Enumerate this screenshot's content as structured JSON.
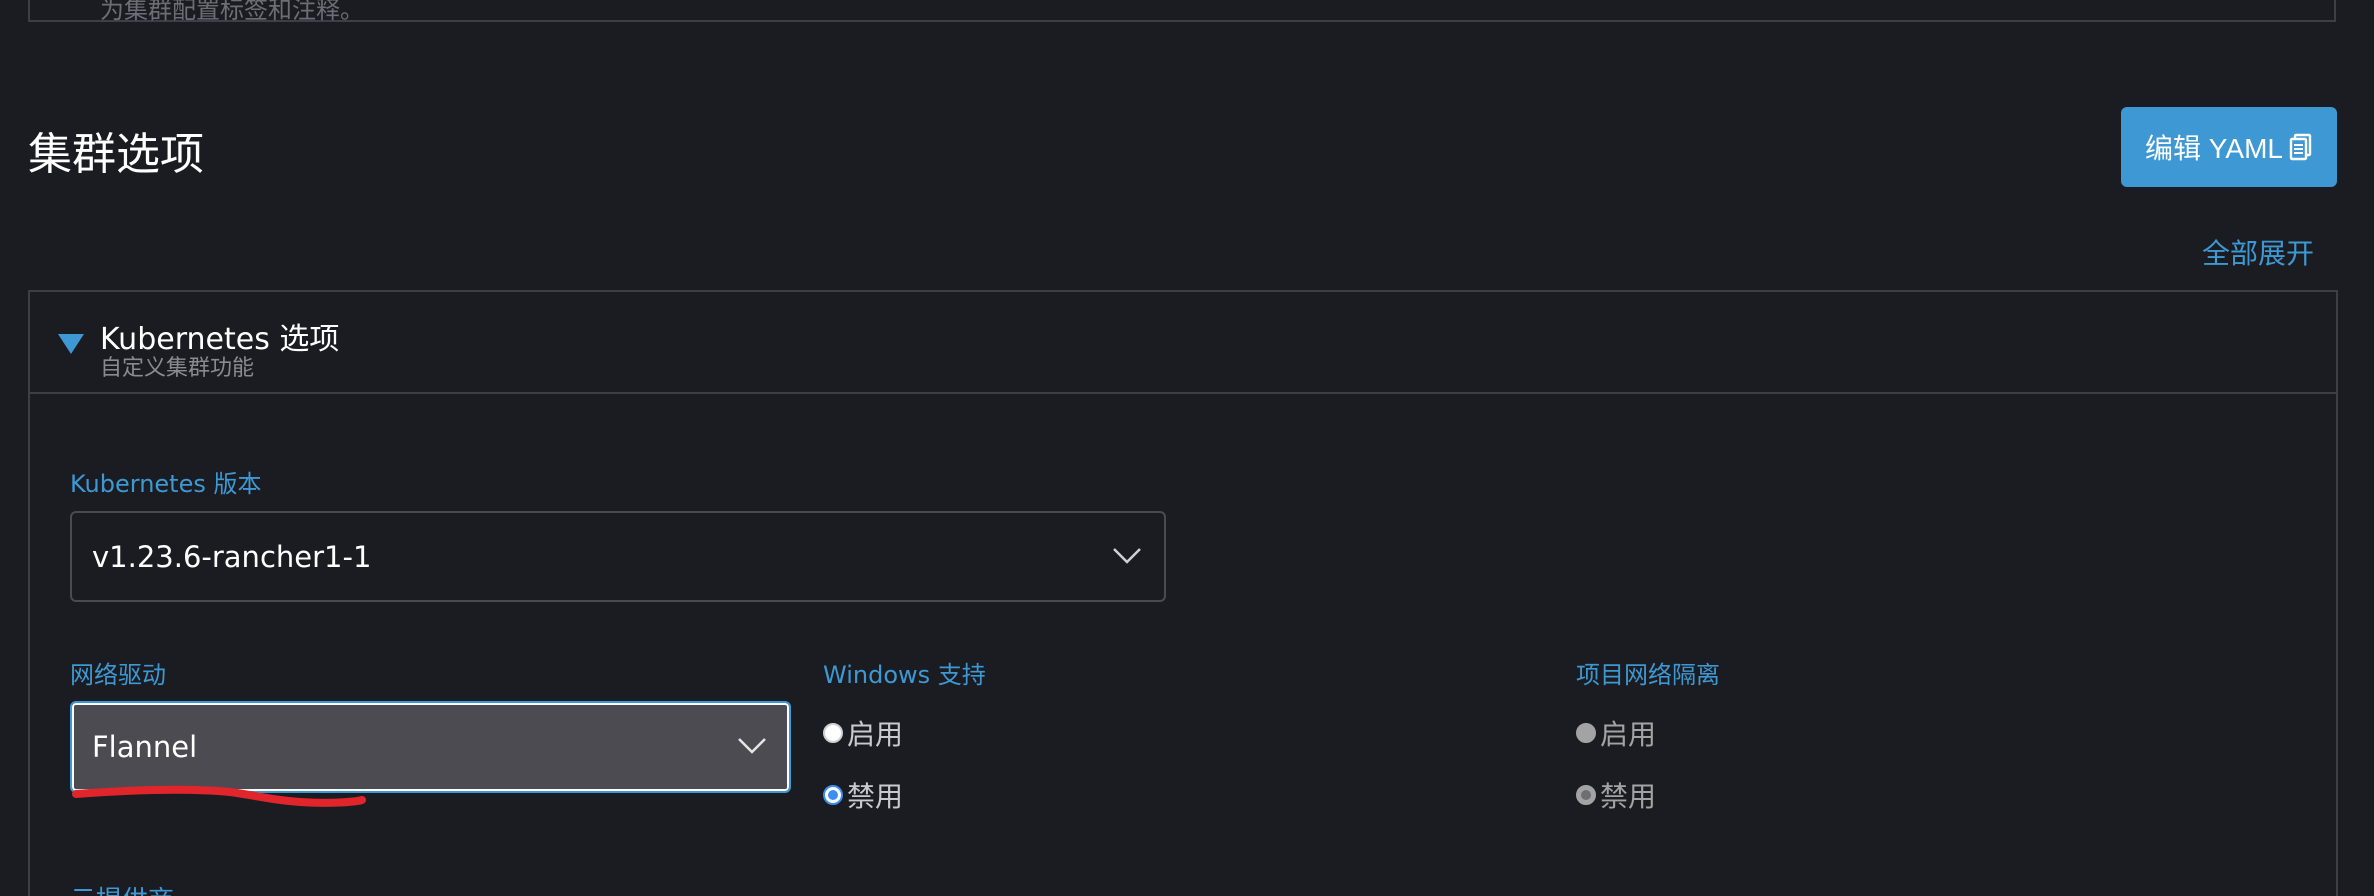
{
  "top_panel": {
    "partial_text": "为集群配置标签和注释。"
  },
  "section": {
    "title": "集群选项",
    "edit_yaml_label": "编辑 YAML",
    "expand_all_label": "全部展开"
  },
  "accordion": {
    "title": "Kubernetes 选项",
    "subtitle": "自定义集群功能"
  },
  "k8s_version": {
    "label": "Kubernetes 版本",
    "value": "v1.23.6-rancher1-1"
  },
  "network": {
    "label": "网络驱动",
    "value": "Flannel"
  },
  "windows_support": {
    "label": "Windows 支持",
    "options": [
      "启用",
      "禁用"
    ],
    "selected": "禁用"
  },
  "project_isolation": {
    "label": "项目网络隔离",
    "options": [
      "启用",
      "禁用"
    ],
    "selected": "禁用",
    "disabled": true
  },
  "bottom": {
    "partial_label": "云提供商"
  },
  "colors": {
    "background": "#1b1c21",
    "accent": "#3d98d3",
    "border": "#3e3f46",
    "annotation": "#e0262b"
  }
}
